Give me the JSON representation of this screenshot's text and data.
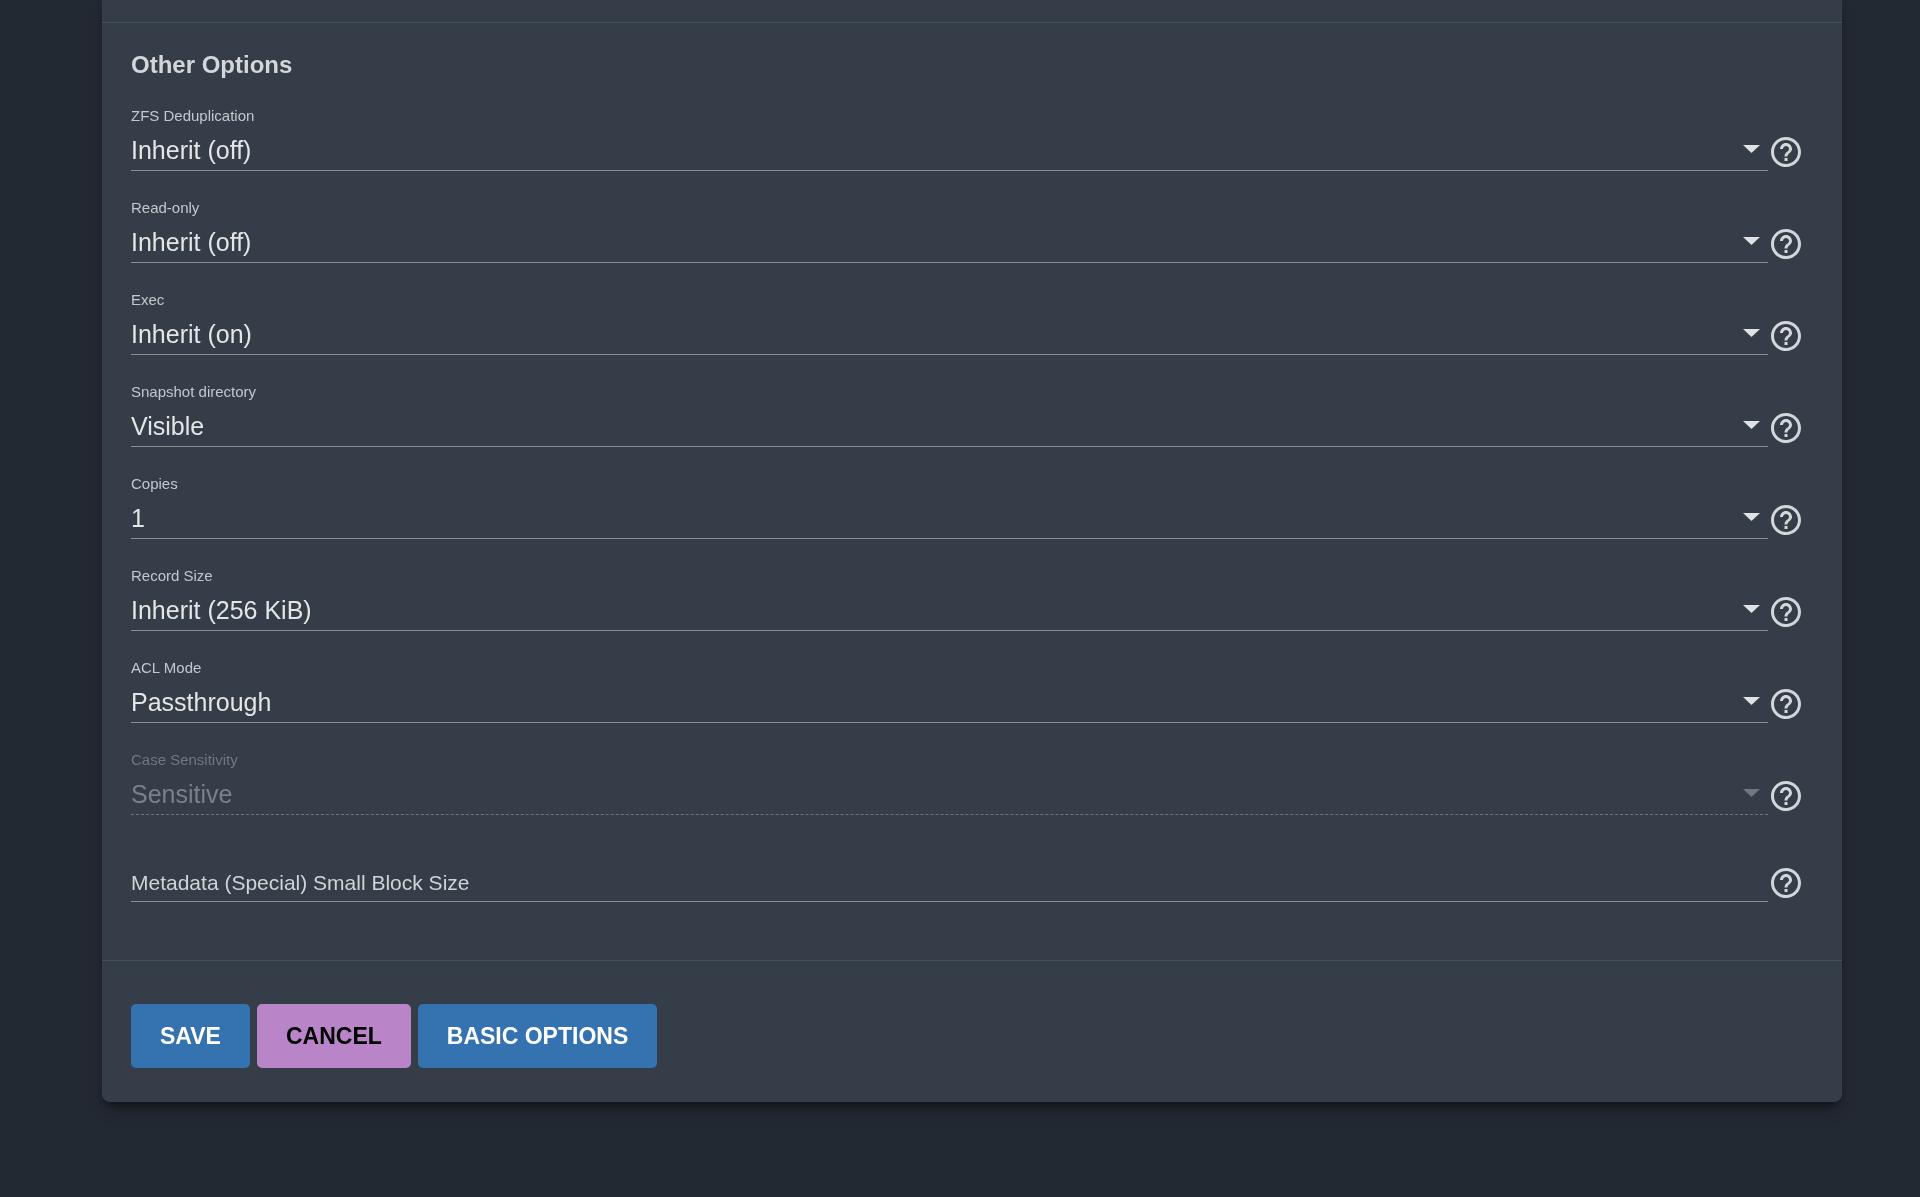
{
  "section": {
    "title": "Other Options"
  },
  "fields": [
    {
      "kind": "select",
      "label": "ZFS Deduplication",
      "value": "Inherit (off)",
      "disabled": false
    },
    {
      "kind": "select",
      "label": "Read-only",
      "value": "Inherit (off)",
      "disabled": false
    },
    {
      "kind": "select",
      "label": "Exec",
      "value": "Inherit (on)",
      "disabled": false
    },
    {
      "kind": "select",
      "label": "Snapshot directory",
      "value": "Visible",
      "disabled": false
    },
    {
      "kind": "select",
      "label": "Copies",
      "value": "1",
      "disabled": false
    },
    {
      "kind": "select",
      "label": "Record Size",
      "value": "Inherit (256 KiB)",
      "disabled": false
    },
    {
      "kind": "select",
      "label": "ACL Mode",
      "value": "Passthrough",
      "disabled": false
    },
    {
      "kind": "select",
      "label": "Case Sensitivity",
      "value": "Sensitive",
      "disabled": true
    },
    {
      "kind": "text",
      "placeholder": "Metadata (Special) Small Block Size",
      "disabled": false
    }
  ],
  "buttons": [
    {
      "label": "SAVE",
      "kind": "primary"
    },
    {
      "label": "CANCEL",
      "kind": "secondary"
    },
    {
      "label": "BASIC OPTIONS",
      "kind": "primary"
    }
  ]
}
